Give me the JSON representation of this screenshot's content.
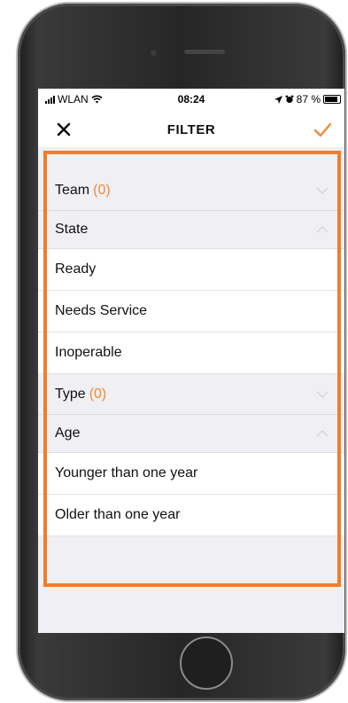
{
  "status_bar": {
    "carrier": "WLAN",
    "time": "08:24",
    "battery_percent": "87 %",
    "battery_level": 0.87,
    "icons": [
      "signal-bars-icon",
      "wifi-icon",
      "location-arrow-icon",
      "alarm-icon",
      "battery-icon"
    ]
  },
  "nav": {
    "title": "FILTER",
    "close_icon": "close-icon",
    "confirm_icon": "checkmark-icon"
  },
  "colors": {
    "accent": "#f08a33",
    "highlight_border": "#ef7d2a",
    "section_bg": "#efeff4"
  },
  "filters": {
    "team": {
      "label": "Team",
      "count": "(0)",
      "expanded": false
    },
    "state": {
      "label": "State",
      "expanded": true,
      "options": [
        "Ready",
        "Needs Service",
        "Inoperable"
      ]
    },
    "type": {
      "label": "Type",
      "count": "(0)",
      "expanded": false
    },
    "age": {
      "label": "Age",
      "expanded": true,
      "options": [
        "Younger than one year",
        "Older than one year"
      ]
    }
  }
}
